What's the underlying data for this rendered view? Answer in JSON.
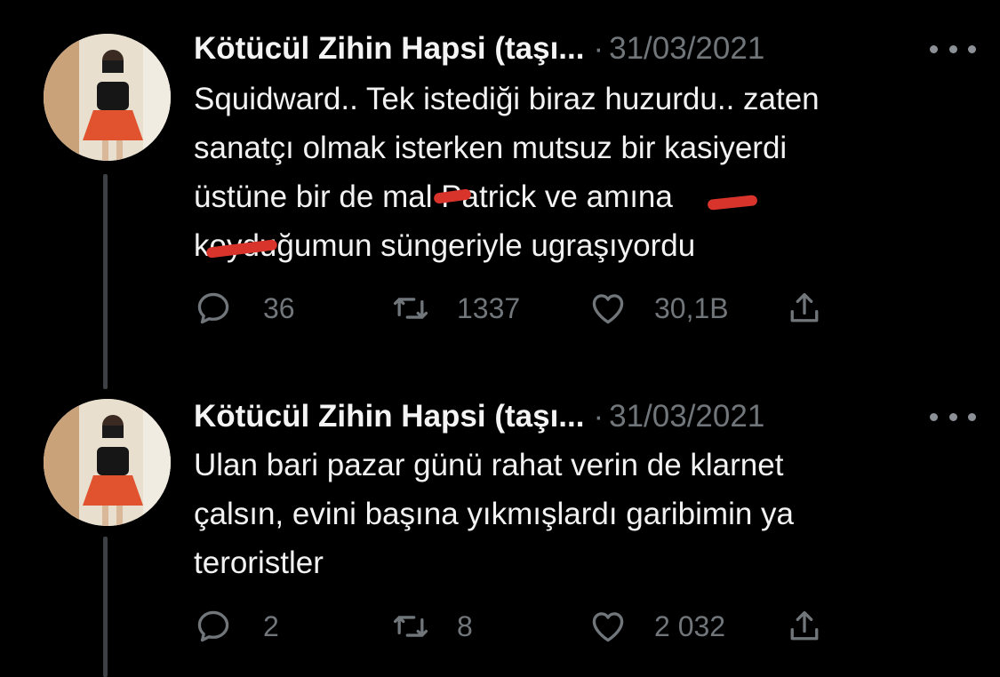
{
  "tweets": [
    {
      "author": "Kötücül Zihin Hapsi (taşı...",
      "separator": "·",
      "date": "31/03/2021",
      "text": "Squidward.. Tek istediği biraz huzurdu.. zaten\nsanatçı olmak isterken mutsuz bir kasiyerdi\nüstüne bir de mal Patrick ve amına\nkoyduğumun süngeriyle ugraşıyordu",
      "reply_count": "36",
      "retweet_count": "1337",
      "like_count": "30,1B"
    },
    {
      "author": "Kötücül Zihin Hapsi (taşı...",
      "separator": "·",
      "date": "31/03/2021",
      "text": "Ulan bari pazar günü rahat verin de  klarnet\nçalsın, evini başına yıkmışlardı garibimin ya\nteroristler",
      "reply_count": "2",
      "retweet_count": "8",
      "like_count": "2 032"
    }
  ],
  "icons": {
    "reply": "reply-icon",
    "retweet": "retweet-icon",
    "like": "heart-icon",
    "share": "share-icon",
    "more": "more-options-icon",
    "redaction": "red-scribble-redaction"
  },
  "colors": {
    "background": "#000000",
    "text": "#e7e9ea",
    "muted": "#71767b",
    "thread_line": "#3d4045",
    "redaction": "#d9342b"
  }
}
